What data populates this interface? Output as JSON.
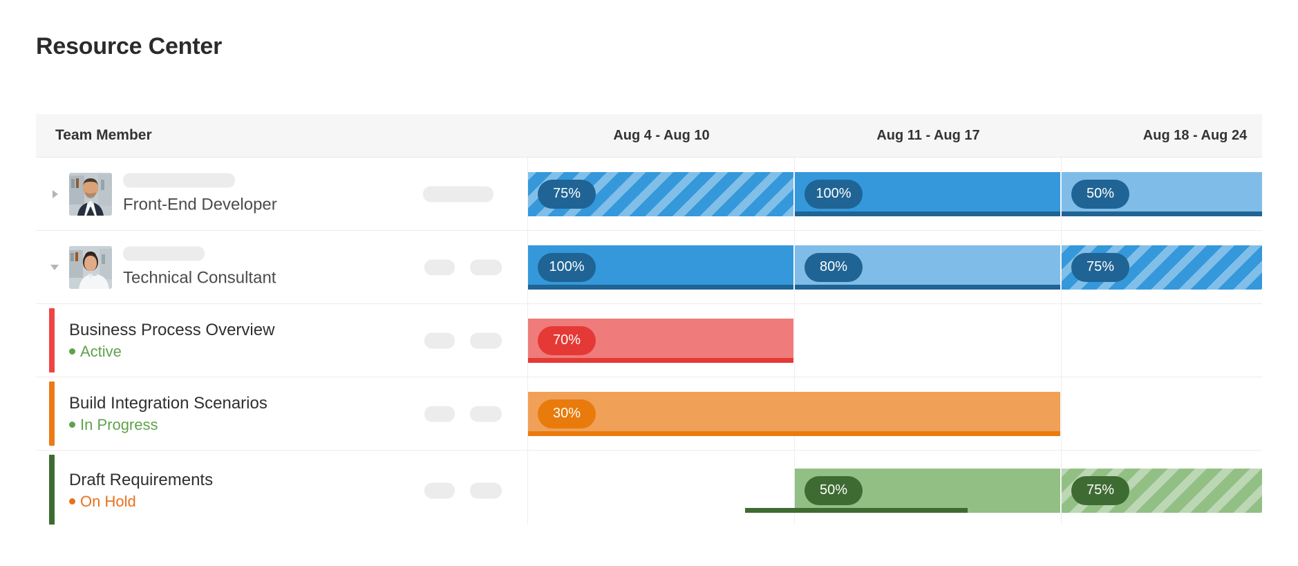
{
  "page": {
    "title": "Resource Center",
    "background": "#ffffff"
  },
  "table": {
    "header": {
      "member_column": "Team Member",
      "date_columns": [
        "Aug 4 - Aug 10",
        "Aug 11 - Aug 17",
        "Aug 18 - Aug 24"
      ]
    }
  },
  "colors": {
    "blue_medium": "#3498db",
    "blue_light": "#7fbde8",
    "blue_dark": "#1f6494",
    "red_light": "#ef7b7b",
    "red_dark": "#e53935",
    "orange_light": "#f0a057",
    "orange_dark": "#e87b0c",
    "green_light": "#92bf84",
    "green_dark": "#3e6b32",
    "status_active": "#5fa24a",
    "status_inprogress": "#5fa24a",
    "status_onhold": "#e8711a",
    "accent_red": "#ef4444",
    "accent_orange": "#ec7a17",
    "accent_green": "#3e6b32",
    "skeleton": "#ececec"
  },
  "rows": [
    {
      "type": "member",
      "twisty": "collapsed",
      "avatar": "avatar-male",
      "name_placeholder": "",
      "role": "Front-End Developer",
      "actions": [
        "action-pill-wide"
      ],
      "bars": [
        {
          "label": "75%",
          "column": 0,
          "span": 1,
          "style": "striped",
          "fill": "#3498db",
          "badge": "#1f6494",
          "progress": 0
        },
        {
          "label": "100%",
          "column": 1,
          "span": 1,
          "style": "solid",
          "fill": "#3498db",
          "badge": "#1f6494",
          "progress": 100
        },
        {
          "label": "50%",
          "column": 2,
          "span": 1,
          "style": "solid",
          "fill": "#7fbde8",
          "badge": "#1f6494",
          "progress": 100
        }
      ]
    },
    {
      "type": "member",
      "twisty": "expanded",
      "avatar": "avatar-female",
      "name_placeholder": "",
      "role": "Technical Consultant",
      "actions": [
        "action-pill",
        "action-pill"
      ],
      "bars": [
        {
          "label": "100%",
          "column": 0,
          "span": 1,
          "style": "solid",
          "fill": "#3498db",
          "badge": "#1f6494",
          "progress": 100
        },
        {
          "label": "80%",
          "column": 1,
          "span": 1,
          "style": "solid",
          "fill": "#7fbde8",
          "badge": "#1f6494",
          "progress": 100
        },
        {
          "label": "75%",
          "column": 2,
          "span": 1,
          "style": "striped",
          "fill": "#3498db",
          "badge": "#1f6494",
          "progress": 0
        }
      ]
    },
    {
      "type": "task",
      "accent": "#ef4444",
      "name": "Business Process Overview",
      "status": "Active",
      "status_color": "#5fa24a",
      "dot_color": "#5fa24a",
      "actions": [
        "action-pill",
        "action-pill"
      ],
      "bars": [
        {
          "label": "70%",
          "column": 0,
          "span": 1,
          "style": "solid",
          "fill": "#ef7b7b",
          "badge": "#e53935",
          "progress": 100
        }
      ]
    },
    {
      "type": "task",
      "accent": "#ec7a17",
      "name": "Build Integration Scenarios",
      "status": "In Progress",
      "status_color": "#5fa24a",
      "dot_color": "#5fa24a",
      "actions": [
        "action-pill",
        "action-pill"
      ],
      "bars": [
        {
          "label": "30%",
          "column": 0,
          "span": 2,
          "style": "solid",
          "fill": "#f0a057",
          "badge": "#e87b0c",
          "progress": 100
        }
      ]
    },
    {
      "type": "task",
      "accent": "#3e6b32",
      "name": "Draft Requirements",
      "status": "On Hold",
      "status_color": "#e8711a",
      "dot_color": "#e8711a",
      "actions": [
        "action-pill",
        "action-pill"
      ],
      "bars": [
        {
          "label": "50%",
          "column": 1,
          "span": 1,
          "style": "solid",
          "fill": "#92bf84",
          "badge": "#3e6b32",
          "progress": 65
        },
        {
          "label": "75%",
          "column": 2,
          "span": 1,
          "style": "striped",
          "fill": "#92bf84",
          "badge": "#3e6b32",
          "progress": 0
        }
      ]
    }
  ]
}
